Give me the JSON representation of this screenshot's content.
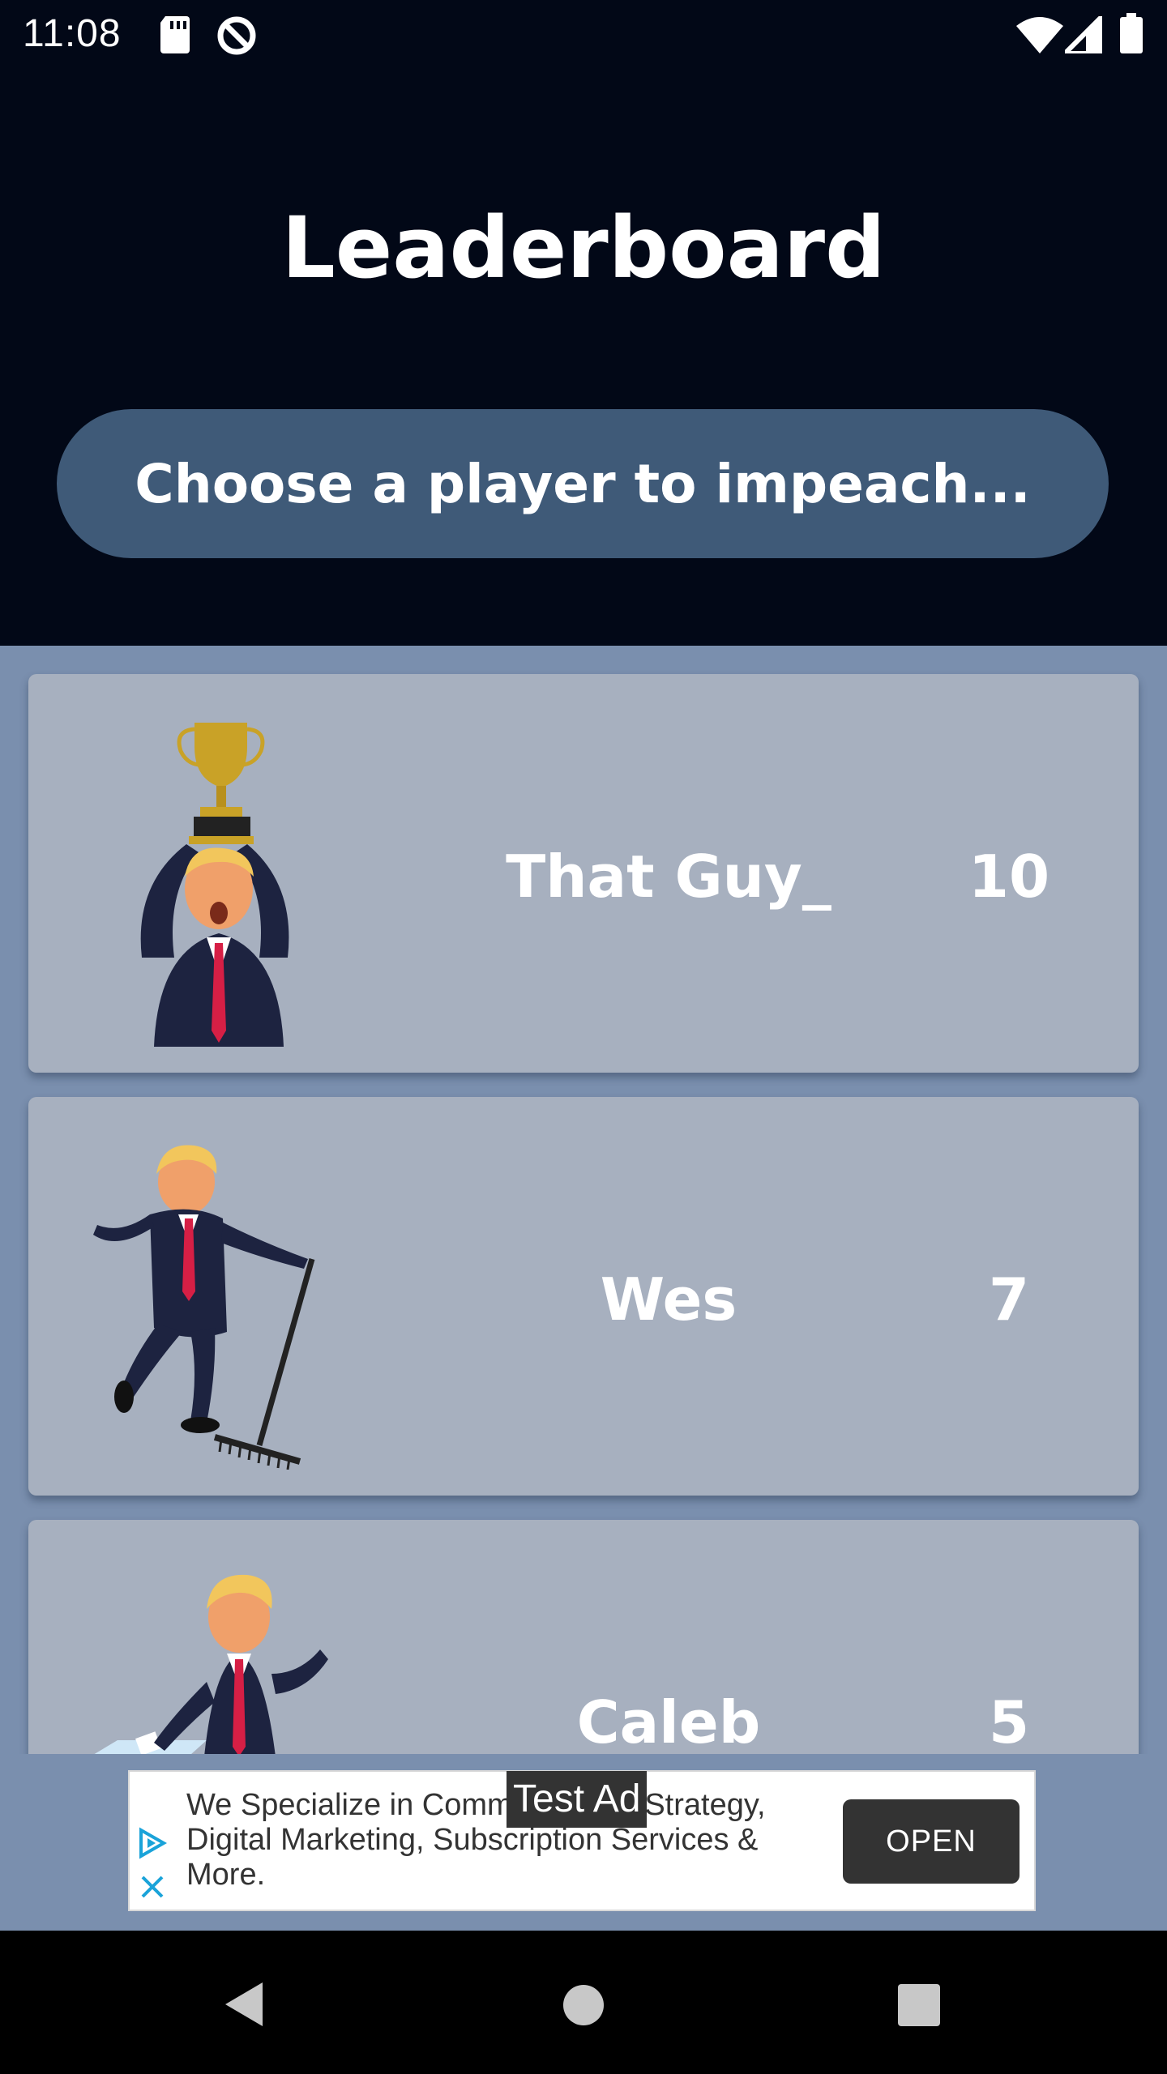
{
  "status_bar": {
    "time": "11:08",
    "icons": [
      "sd-card-icon",
      "data-saver-icon",
      "wifi-icon",
      "cell-signal-icon",
      "battery-icon"
    ]
  },
  "header": {
    "title": "Leaderboard",
    "choose_button": "Choose a player to impeach..."
  },
  "players": [
    {
      "name": "That Guy_",
      "score": "10",
      "avatar": "trump-trophy-avatar"
    },
    {
      "name": "Wes",
      "score": "7",
      "avatar": "trump-rake-avatar"
    },
    {
      "name": "Caleb",
      "score": "5",
      "avatar": "trump-ballot-avatar"
    }
  ],
  "ad": {
    "label": "Test Ad",
    "text": "We Specialize in Communication Strategy, Digital Marketing, Subscription Services & More.",
    "open_label": "OPEN"
  },
  "colors": {
    "header_bg": "#020817",
    "button_bg": "#3f5a78",
    "list_bg": "#7a8fae",
    "card_bg": "#a7b0bf"
  }
}
